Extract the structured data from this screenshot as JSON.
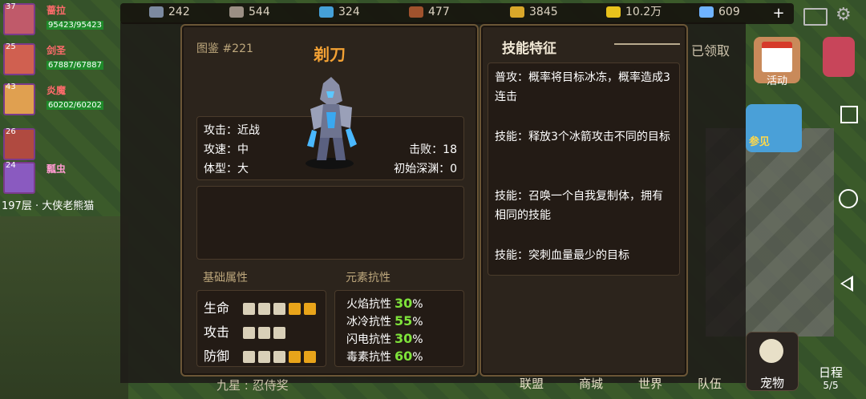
{
  "resources": [
    {
      "icon": "mountain-icon",
      "value": "242",
      "color": "#7c8aa0"
    },
    {
      "icon": "ore-icon",
      "value": "544",
      "color": "#9b8f84"
    },
    {
      "icon": "crystal-icon",
      "value": "324",
      "color": "#45a0d8"
    },
    {
      "icon": "wood-icon",
      "value": "477",
      "color": "#a0522d"
    },
    {
      "icon": "wheat-icon",
      "value": "3845",
      "color": "#d9a72a"
    },
    {
      "icon": "coin-icon",
      "value": "10.2万",
      "color": "#e8c21c"
    },
    {
      "icon": "diamond-icon",
      "value": "609",
      "color": "#6fb3ff"
    }
  ],
  "plus_label": "+",
  "party": [
    {
      "level": "37",
      "name": "蔷拉",
      "hp": "95423/95423"
    },
    {
      "level": "25",
      "name": "剑圣",
      "hp": "67887/67887"
    },
    {
      "level": "43",
      "name": "炎魔",
      "hp": "60202/60202"
    },
    {
      "level": "26",
      "name": "",
      "hp": ""
    },
    {
      "level": "24",
      "name": "瓢虫",
      "hp": ""
    }
  ],
  "floor_text": "197层 · 大侠老熊猫",
  "sidebar": {
    "activity_label": "活动",
    "join_label": "参见",
    "pet_label": "宠物",
    "schedule_label": "日程",
    "schedule_count": "5/5"
  },
  "ghost": {
    "claim_label": "已领取",
    "chat_text": "九星 : 忍侍奖"
  },
  "bottom_tabs": [
    "联盟",
    "商城",
    "世界",
    "队伍"
  ],
  "detail": {
    "dex_label": "图鉴 #221",
    "monster_name": "剃刀",
    "attack_type": "攻击：近战",
    "attack_speed": "攻速：中",
    "body_size": "体型：大",
    "defeats": "击败：18",
    "start_depth": "初始深渊：0",
    "basic_attr_title": "基础属性",
    "elem_res_title": "元素抗性",
    "attributes": [
      {
        "label": "生命",
        "filled": 5,
        "light": 3
      },
      {
        "label": "攻击",
        "filled": 3,
        "light": 3
      },
      {
        "label": "防御",
        "filled": 5,
        "light": 3
      }
    ],
    "resistances": [
      {
        "label": "火焰抗性",
        "value": "30",
        "unit": "%"
      },
      {
        "label": "冰冷抗性",
        "value": "55",
        "unit": "%"
      },
      {
        "label": "闪电抗性",
        "value": "30",
        "unit": "%"
      },
      {
        "label": "毒素抗性",
        "value": "60",
        "unit": "%"
      }
    ]
  },
  "skills_panel": {
    "title": "技能特征",
    "skills": [
      "普攻：概率将目标冰冻，概率造成3连击",
      "技能：释放3个冰箭攻击不同的目标",
      "技能：召唤一个自我复制体，拥有相同的技能",
      "技能：突刺血量最少的目标"
    ]
  }
}
